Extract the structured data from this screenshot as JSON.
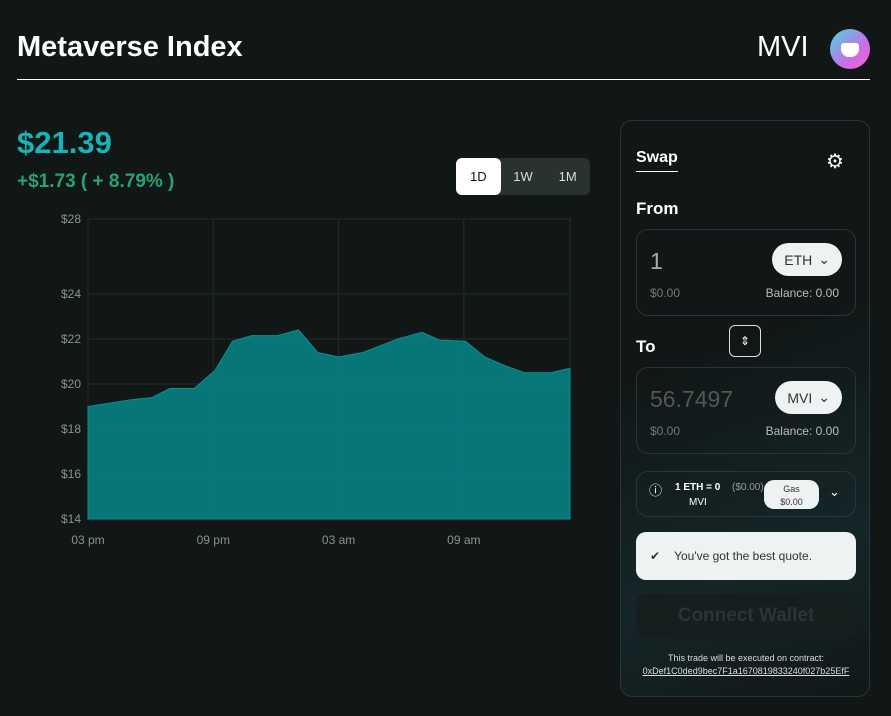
{
  "header": {
    "title": "Metaverse Index",
    "symbol": "MVI",
    "logo": "mvi-logo"
  },
  "price": {
    "current": "$21.39",
    "change": "+$1.73 ( + 8.79% )",
    "color": "#17b3b6",
    "change_color": "#27a36f"
  },
  "periods": [
    {
      "label": "1D",
      "active": true
    },
    {
      "label": "1W",
      "active": false
    },
    {
      "label": "1M",
      "active": false
    }
  ],
  "chart_data": {
    "type": "area",
    "title": "",
    "xlabel": "",
    "ylabel": "",
    "color": "#077b7e",
    "grid": true,
    "x": [
      "15:00",
      "17:04",
      "18:05",
      "18:55",
      "20:05",
      "21:05",
      "21:55",
      "22:50",
      "00:05",
      "01:05",
      "02:00",
      "03:00",
      "04:10",
      "05:50",
      "07:00",
      "07:50",
      "09:05",
      "10:00",
      "11:00",
      "11:55",
      "13:10",
      "14:05"
    ],
    "values": [
      19.0,
      19.3,
      19.4,
      19.8,
      19.8,
      20.6,
      21.9,
      22.15,
      22.15,
      22.4,
      21.4,
      21.2,
      21.4,
      22.0,
      22.3,
      21.95,
      21.9,
      21.2,
      20.8,
      20.5,
      20.5,
      20.7
    ],
    "yticks": [
      "$14",
      "$16",
      "$18",
      "$20",
      "$22",
      "$24",
      "$28"
    ],
    "ytick_values": [
      14,
      16,
      18,
      20,
      22,
      24,
      28
    ],
    "xticks": [
      "03 pm",
      "09 pm",
      "03 am",
      "09 am"
    ],
    "xtick_values": [
      "15:00",
      "21:00",
      "03:00",
      "09:00"
    ],
    "ylim": [
      14,
      28
    ]
  },
  "swap": {
    "tab": "Swap",
    "settings_icon": "gear-icon",
    "from_label": "From",
    "to_label": "To",
    "from": {
      "amount": "1",
      "token": "ETH",
      "usd": "$0.00",
      "balance": "Balance: 0.00"
    },
    "to": {
      "amount": "56.7497",
      "token": "MVI",
      "usd": "$0.00",
      "balance": "Balance: 0.00"
    },
    "rate": {
      "text": "1 ETH = 0",
      "unit": "MVI",
      "usd": "($0.00)",
      "gas_label": "Gas",
      "gas_value": "$0.00"
    },
    "best_quote": "You've got the best quote.",
    "connect": "Connect Wallet",
    "contract_note": "This trade will be executed on contract:",
    "contract": "0xDef1C0ded9bec7F1a1670819833240f027b25EfF"
  }
}
